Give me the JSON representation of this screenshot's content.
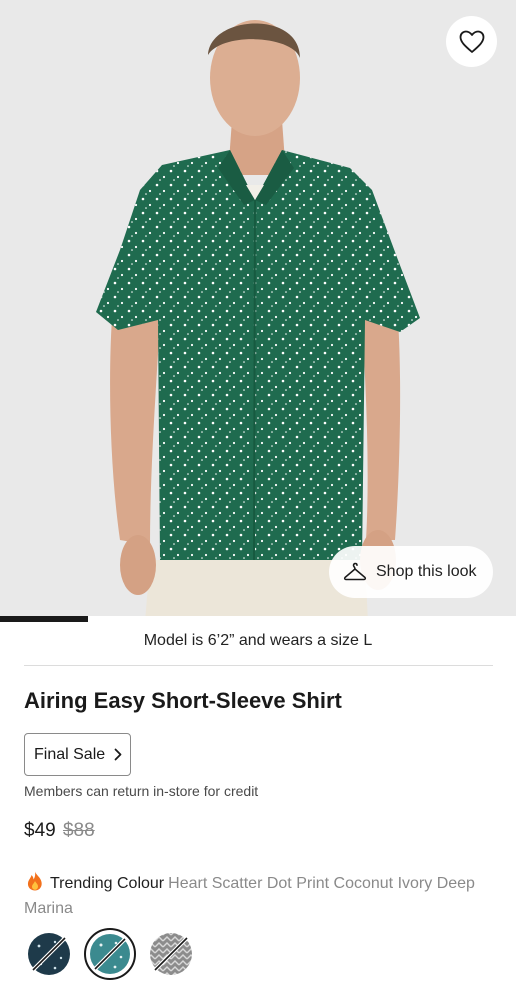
{
  "hero": {
    "favorite_icon": "heart-outline-icon",
    "shop_look_icon": "hanger-icon",
    "shop_look_label": "Shop this look",
    "gallery_progress": 0.17
  },
  "product": {
    "model_note": "Model is 6’2” and wears a size L",
    "title": "Airing Easy Short-Sleeve Shirt",
    "final_sale_label": "Final Sale",
    "return_note": "Members can return in-store for credit",
    "price": "$49",
    "original_price": "$88",
    "trending_label": "Trending Colour",
    "colour_name": "Heart Scatter Dot Print Coconut Ivory Deep Marina"
  },
  "colours": {
    "accent": "#1f6b4f",
    "swatches": [
      {
        "name": "navy dot print",
        "color": "#1e3a4a",
        "selected": false
      },
      {
        "name": "teal heart print",
        "color": "#3b8a8f",
        "selected": true
      },
      {
        "name": "grey pattern",
        "color": "#7f7f7f",
        "selected": false
      }
    ]
  }
}
